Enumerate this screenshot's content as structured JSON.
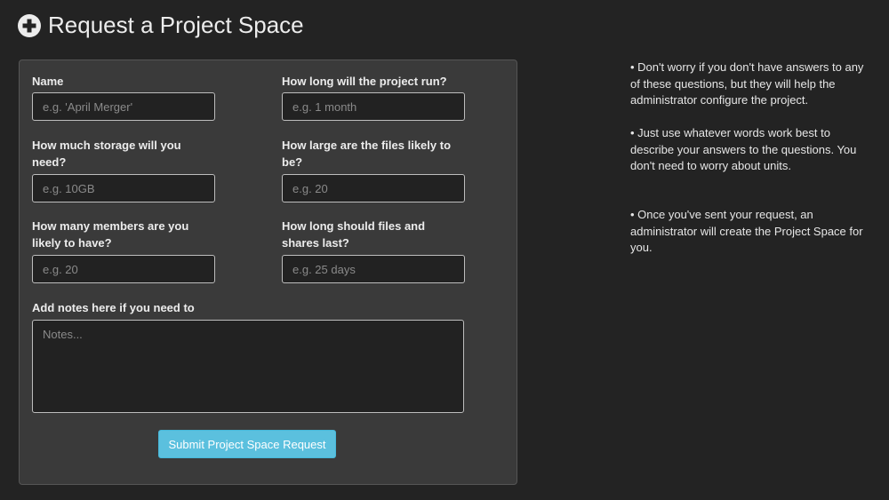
{
  "header": {
    "title": "Request a Project Space",
    "icon": "plus-circle-icon"
  },
  "form": {
    "name": {
      "label": "Name",
      "placeholder": "e.g. 'April Merger'"
    },
    "duration": {
      "label": "How long will the project run?",
      "placeholder": "e.g. 1 month"
    },
    "storage": {
      "label": "How much storage will you need?",
      "placeholder": "e.g. 10GB"
    },
    "file_size": {
      "label": "How large are the files likely to be?",
      "placeholder": "e.g. 20"
    },
    "members": {
      "label": "How many members are you likely to have?",
      "placeholder": "e.g. 20"
    },
    "retention": {
      "label": "How long should files and shares last?",
      "placeholder": "e.g. 25 days"
    },
    "notes": {
      "label": "Add notes here if you need to",
      "placeholder": "Notes..."
    },
    "submit_label": "Submit Project Space Request"
  },
  "help": {
    "items": [
      "• Don't worry if you don't have answers to any of these questions, but they will help the administrator configure the project.",
      "• Just use whatever words work best to describe your answers to the questions. You don't need to worry about units.",
      "• Once you've sent your request, an administrator will create the Project Space for you."
    ]
  },
  "colors": {
    "background": "#232323",
    "panel": "#3a3a3a",
    "accent": "#5bc0de"
  }
}
